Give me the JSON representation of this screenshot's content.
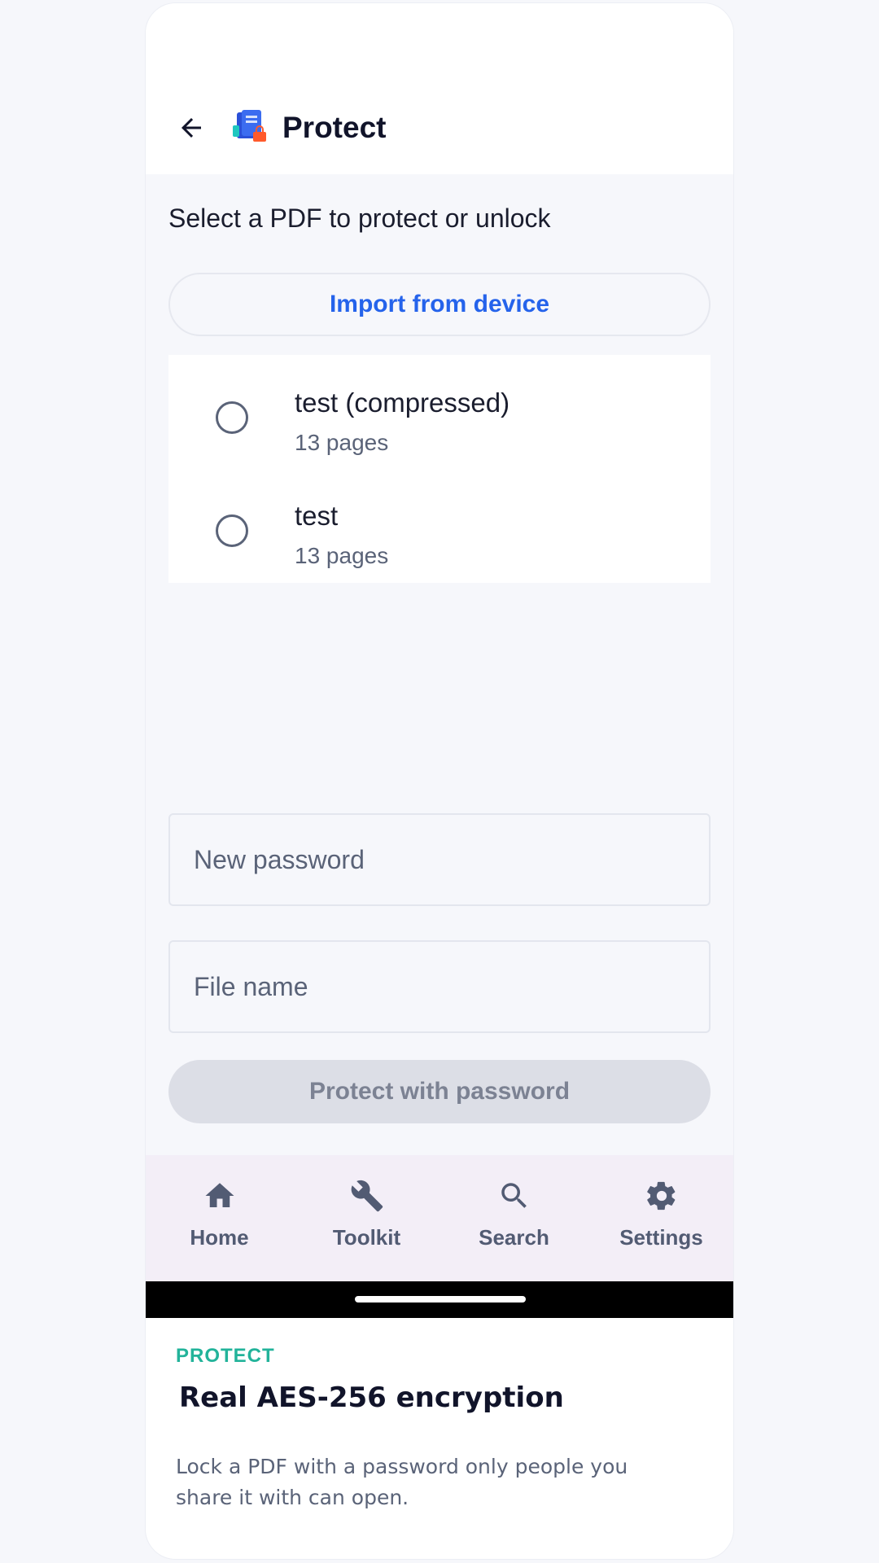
{
  "app_bar": {
    "title": "Protect",
    "back_icon": "arrow-left-icon",
    "logo_icon": "pdf-lock-logo-icon"
  },
  "main": {
    "prompt": "Select a PDF to protect or unlock",
    "import_label": "Import from device",
    "files": [
      {
        "name": "test (compressed)",
        "meta": "13 pages",
        "selected": false
      },
      {
        "name": "test",
        "meta": "13 pages",
        "selected": false
      }
    ],
    "password_placeholder": "New password",
    "filename_placeholder": "File name",
    "protect_label": "Protect with password"
  },
  "bottom_nav": {
    "items": [
      {
        "label": "Home",
        "icon": "home-icon"
      },
      {
        "label": "Toolkit",
        "icon": "wrench-icon"
      },
      {
        "label": "Search",
        "icon": "search-icon"
      },
      {
        "label": "Settings",
        "icon": "gear-icon"
      }
    ]
  },
  "promo": {
    "tag": "PROTECT",
    "title": "Real AES-256 encryption",
    "description": "Lock a PDF with a password only people you share it with can open."
  },
  "colors": {
    "accent_blue": "#2563eb",
    "promo_tag_green": "#22b39a",
    "nav_background": "#f3eef7",
    "disabled_button": "#dcdee6"
  }
}
